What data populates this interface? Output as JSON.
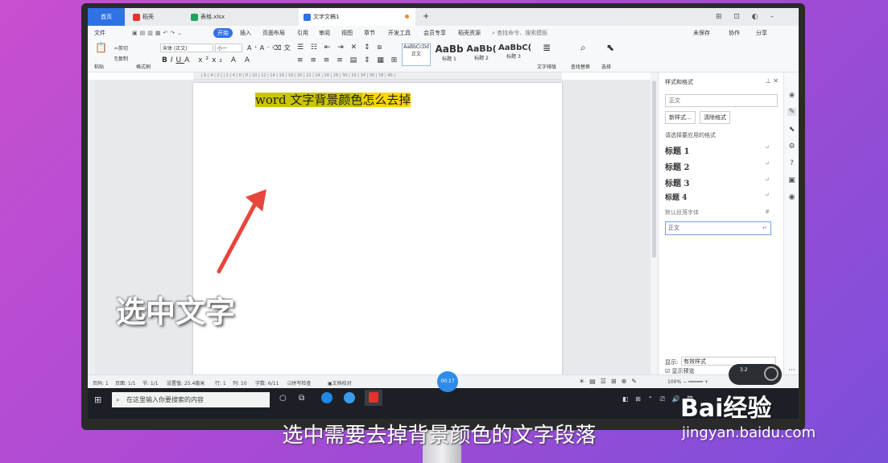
{
  "tabs": {
    "home": "首页",
    "daoke": "稻壳",
    "xlsx": "表格.xlsx",
    "doc": "文字文稿1",
    "new_tab": "+"
  },
  "menu": {
    "file": "文件",
    "start": "开始",
    "insert": "插入",
    "layout": "页面布局",
    "ref": "引用",
    "review": "审阅",
    "view": "视图",
    "chapter": "章节",
    "dev": "开发工具",
    "member": "会员专享",
    "resources": "稻壳资源",
    "search": "查找命令、搜索模板",
    "unsynced": "未保存",
    "collab": "协作",
    "share": "分享"
  },
  "ribbon": {
    "cut": "剪切",
    "paste": "粘贴",
    "copy": "复制",
    "format_painter": "格式刷",
    "font": "宋体 (正文)",
    "size": "小一",
    "styles": [
      "AaBbCcDd",
      "AaBb",
      "AaBb(",
      "AaBbC("
    ],
    "style_names": [
      "正文",
      "标题 1",
      "标题 2",
      "标题 3"
    ],
    "text_layout": "文字排版",
    "find_replace": "查找替换",
    "select": "选择"
  },
  "ruler_marks": "| 6 | 4 | 2 |   | 2 | 4 | 6 | 8 | 10 | 12 | 14 | 16 | 18 | 20 | 22 | 24 | 26 | 28 | 30 | 32 | 34 | 36 | 38 | 40 |",
  "document": {
    "text_a": "word 文字背景颜色",
    "text_b": "怎么去掉"
  },
  "overlay": {
    "annotation": "选中文字",
    "caption": "选中需要去掉背景颜色的文字段落",
    "timer": "00:17",
    "watermark": "Bai经验",
    "watermark_url": "jingyan.baidu.com",
    "pill": "3.2"
  },
  "pane": {
    "title": "样式和格式",
    "current": "正文",
    "new_style": "新样式...",
    "clear": "清除格式",
    "prompt": "请选择要应用的格式",
    "styles": [
      "标题 1",
      "标题 2",
      "标题 3",
      "标题 4"
    ],
    "default_font": "默认段落字体",
    "body": "正文",
    "show_label": "显示:",
    "show_value": "有效样式",
    "preview": "显示预览"
  },
  "status": {
    "page": "页码: 1",
    "pages": "页面: 1/1",
    "section": "节: 1/1",
    "setting": "设置值: 25.4毫米",
    "row": "行: 1",
    "col": "列: 10",
    "words": "字数: 6/11",
    "spell": "拼写检查",
    "proof": "文档校对",
    "zoom": "100%"
  },
  "taskbar": {
    "search": "在这里输入你要搜索的内容",
    "lang": "简"
  }
}
